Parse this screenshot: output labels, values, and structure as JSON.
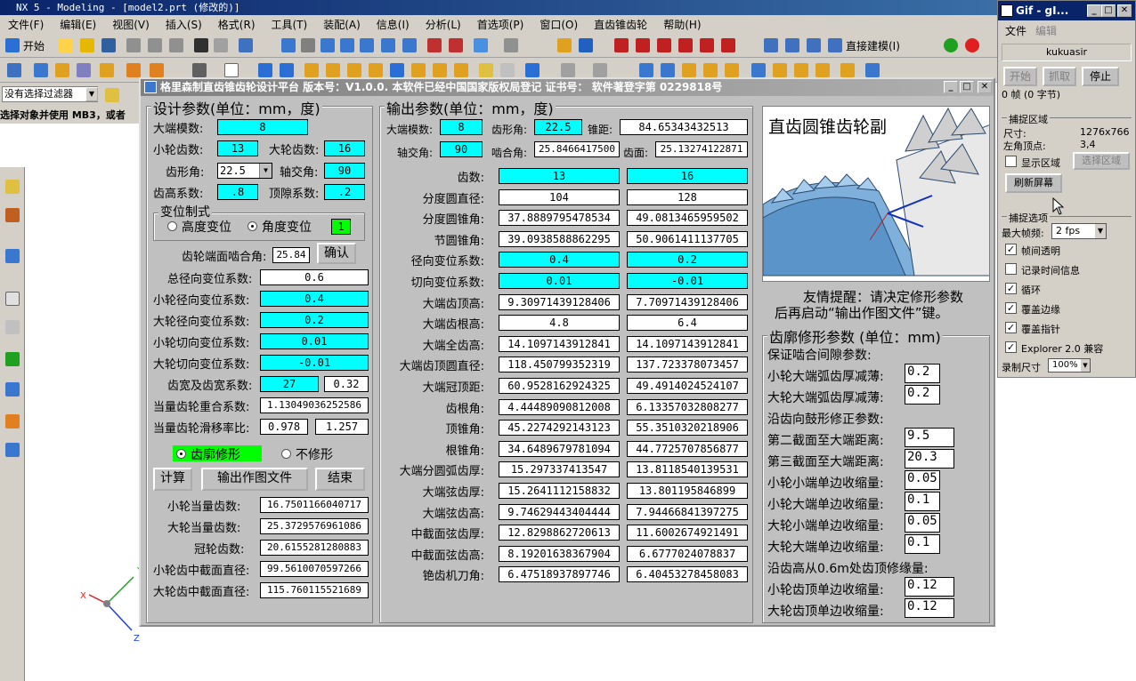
{
  "nx": {
    "title": "NX 5 - Modeling - [model2.prt (修改的)]",
    "menu": [
      "文件(F)",
      "编辑(E)",
      "视图(V)",
      "插入(S)",
      "格式(R)",
      "工具(T)",
      "装配(A)",
      "信息(I)",
      "分析(L)",
      "首选项(P)",
      "窗口(O)",
      "直齿锥齿轮",
      "帮助(H)"
    ],
    "start_label": "开始",
    "direct_modeling": "直接建模(I)",
    "filter_label": "没有选择过滤器",
    "status_text": "选择对象并使用 MB3，或者"
  },
  "dialog": {
    "title": "格里森制直齿锥齿轮设计平台   版本号：V1.0.0.   本软件已经中国国家版权局登记   证书号：  软件著登字第 0229818号",
    "design": {
      "title": "设计参数(单位：mm，度)",
      "module_label": "大端模数:",
      "module": "8",
      "z1_label": "小轮齿数:",
      "z1": "13",
      "z2_label": "大轮齿数:",
      "z2": "16",
      "alpha_label": "齿形角:",
      "alpha": "22.5",
      "sigma_label": "轴交角:",
      "sigma": "90",
      "ha_label": "齿高系数:",
      "ha": ".8",
      "c_label": "顶隙系数:",
      "c": ".2",
      "shift_title": "变位制式",
      "shift_height": "高度变位",
      "shift_angle": "角度变位",
      "shift_value": "1",
      "face_angle_label": "齿轮端面啮合角:",
      "face_angle": "25.84",
      "confirm": "确认",
      "total_x_label": "总径向变位系数:",
      "total_x": "0.6",
      "x1_label": "小轮径向变位系数:",
      "x1": "0.4",
      "x2_label": "大轮径向变位系数:",
      "x2": "0.2",
      "xt1_label": "小轮切向变位系数:",
      "xt1": "0.01",
      "xt2_label": "大轮切向变位系数:",
      "xt2": "-0.01",
      "width_label": "齿宽及齿宽系数:",
      "width": "27",
      "width_coef": "0.32",
      "overlap_label": "当量齿轮重合系数:",
      "overlap": "1.13049036252586",
      "slip_label": "当量齿轮滑移率比:",
      "slip1": "0.978",
      "slip2": "1.257",
      "mod_on": "齿廓修形",
      "mod_off": "不修形",
      "calc": "计算",
      "output": "输出作图文件",
      "end": "结束",
      "zv1_label": "小轮当量齿数:",
      "zv1": "16.7501166040717",
      "zv2_label": "大轮当量齿数:",
      "zv2": "25.3729576961086",
      "zc_label": "冠轮齿数:",
      "zc": "20.6155281280883",
      "dm1_label": "小轮齿中截面直径:",
      "dm1": "99.5610070597266",
      "dm2_label": "大轮齿中截面直径:",
      "dm2": "115.760115521689"
    },
    "output": {
      "title": "输出参数(单位：mm，度)",
      "m_label": "大端模数:",
      "m": "8",
      "a_label": "齿形角:",
      "a": "22.5",
      "R_label": "锥距:",
      "R": "84.65343432513",
      "s_label": "轴交角:",
      "s": "90",
      "w_label": "啮合角:",
      "w": "25.8466417500",
      "wt_label": "齿面:",
      "wt": "25.13274122871",
      "rows": [
        {
          "label": "齿数:",
          "v1": "13",
          "v2": "16",
          "cyan": true
        },
        {
          "label": "分度圆直径:",
          "v1": "104",
          "v2": "128",
          "cyan": false
        },
        {
          "label": "分度圆锥角:",
          "v1": "37.8889795478534",
          "v2": "49.0813465959502",
          "cyan": false
        },
        {
          "label": "节圆锥角:",
          "v1": "39.0938588862295",
          "v2": "50.9061411137705",
          "cyan": false
        },
        {
          "label": "径向变位系数:",
          "v1": "0.4",
          "v2": "0.2",
          "cyan": true
        },
        {
          "label": "切向变位系数:",
          "v1": "0.01",
          "v2": "-0.01",
          "cyan": true
        },
        {
          "label": "大端齿顶高:",
          "v1": "9.30971439128406",
          "v2": "7.70971439128406",
          "cyan": false
        },
        {
          "label": "大端齿根高:",
          "v1": "4.8",
          "v2": "6.4",
          "cyan": false
        },
        {
          "label": "大端全齿高:",
          "v1": "14.1097143912841",
          "v2": "14.1097143912841",
          "cyan": false
        },
        {
          "label": "大端齿顶圆直径:",
          "v1": "118.450799352319",
          "v2": "137.723378073457",
          "cyan": false
        },
        {
          "label": "大端冠顶距:",
          "v1": "60.9528162924325",
          "v2": "49.4914024524107",
          "cyan": false
        },
        {
          "label": "齿根角:",
          "v1": "4.44489090812008",
          "v2": "6.13357032808277",
          "cyan": false
        },
        {
          "label": "顶锥角:",
          "v1": "45.2274292143123",
          "v2": "55.3510320218906",
          "cyan": false
        },
        {
          "label": "根锥角:",
          "v1": "34.6489679781094",
          "v2": "44.7725707856877",
          "cyan": false
        },
        {
          "label": "大端分圆弧齿厚:",
          "v1": "15.297337413547",
          "v2": "13.8118540139531",
          "cyan": false
        },
        {
          "label": "大端弦齿厚:",
          "v1": "15.2641112158832",
          "v2": "13.801195846899",
          "cyan": false
        },
        {
          "label": "大端弦齿高:",
          "v1": "9.74629443404444",
          "v2": "7.94466841397275",
          "cyan": false
        },
        {
          "label": "中截面弦齿厚:",
          "v1": "12.8298862720613",
          "v2": "11.6002674921491",
          "cyan": false
        },
        {
          "label": "中截面弦齿高:",
          "v1": "8.19201638367904",
          "v2": "6.6777024078837",
          "cyan": false
        },
        {
          "label": "铯齿机刀角:",
          "v1": "6.47518937897746",
          "v2": "6.40453278458083",
          "cyan": false
        }
      ]
    },
    "image": {
      "title": "直齿圆锥齿轮副",
      "tip1": "友情提醒：请决定修形参数",
      "tip2": "后再启动“输出作图文件”键。"
    },
    "mod": {
      "title": "齿廓修形参数 (单位：mm)",
      "sec1": "保证啮合间隙参数:",
      "r1_label": "小轮大端弧齿厚减薄:",
      "r1": "0.2",
      "r2_label": "大轮大端弧齿厚减薄:",
      "r2": "0.2",
      "sec2": "沿齿向鼓形修正参数:",
      "r3_label": "第二截面至大端距离:",
      "r3": "9.5",
      "r4_label": "第三截面至大端距离:",
      "r4": "20.3",
      "r5_label": "小轮小端单边收缩量:",
      "r5": "0.05",
      "r6_label": "小轮大端单边收缩量:",
      "r6": "0.1",
      "r7_label": "大轮小端单边收缩量:",
      "r7": "0.05",
      "r8_label": "大轮大端单边收缩量:",
      "r8": "0.1",
      "sec3": "沿齿高从0.6m处齿顶修缘量:",
      "r9_label": "小轮齿顶单边收缩量:",
      "r9": "0.12",
      "r10_label": "大轮齿顶单边收缩量:",
      "r10": "0.12"
    }
  },
  "gif": {
    "title": "Gif - gI...",
    "menu_file": "文件",
    "menu_edit": "编辑",
    "user": "kukuasir",
    "start": "开始",
    "capture": "抓取",
    "stop": "停止",
    "frames": "0 帧 (0 字节)",
    "region_title": "捕捉区域",
    "size_label": "尺寸:",
    "size": "1276x766",
    "corner_label": "左角顶点:",
    "corner": "3,4",
    "show_region": "显示区域",
    "select_region": "选择区域",
    "refresh": "刷新屏幕",
    "options_title": "捕捉选项",
    "fps_label": "最大帧频:",
    "fps": "2 fps",
    "opt1": "帧间透明",
    "opt2": "记录时间信息",
    "opt3": "循环",
    "opt4": "覆盖边缘",
    "opt5": "覆盖指针",
    "opt6": "Explorer 2.0 兼容",
    "rec_label": "录制尺寸",
    "rec": "100%"
  }
}
